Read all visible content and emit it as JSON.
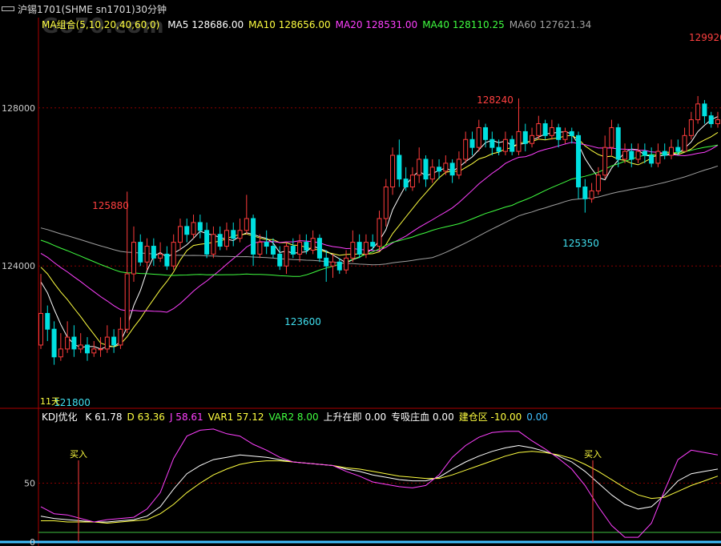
{
  "title": "沪锡1701(SHME sn1701)30分钟",
  "watermark": "Go70.com",
  "ma_legend": {
    "combo": "MA组合(5,10,20,40,60,0)",
    "items": [
      {
        "label": "MA5",
        "value": "128686.00",
        "color": "#ffffff"
      },
      {
        "label": "MA10",
        "value": "128656.00",
        "color": "#ffff40"
      },
      {
        "label": "MA20",
        "value": "128531.00",
        "color": "#ff40ff"
      },
      {
        "label": "MA40",
        "value": "128110.25",
        "color": "#40ff40"
      },
      {
        "label": "MA60",
        "value": "127621.34",
        "color": "#a0a0a0"
      }
    ]
  },
  "kdj_legend": {
    "name": "KDJ优化",
    "items": [
      {
        "label": "K",
        "value": "61.78",
        "color": "#ffffff"
      },
      {
        "label": "D",
        "value": "63.36",
        "color": "#ffff40"
      },
      {
        "label": "J",
        "value": "58.61",
        "color": "#ff40ff"
      },
      {
        "label": "VAR1",
        "value": "57.12",
        "color": "#ffff40"
      },
      {
        "label": "VAR2",
        "value": "8.00",
        "color": "#40ff40"
      },
      {
        "label": "上升在即",
        "value": "0.00",
        "color": "#ffffff"
      },
      {
        "label": "专吸庄血",
        "value": "0.00",
        "color": "#ffffff"
      },
      {
        "label": "建仓区",
        "value": "-10.00",
        "color": "#ffff40"
      },
      {
        "label": "",
        "value": "0.00",
        "color": "#40c0ff"
      }
    ]
  },
  "axis": {
    "price_ticks": [
      "128000",
      "124000"
    ],
    "kdj_ticks": [
      "50",
      "0"
    ],
    "date_label": "11天"
  },
  "annotations": {
    "high_right": "129920",
    "peak_mid": "128240",
    "peak_left": "125880",
    "low_mid": "123600",
    "low_right": "125350",
    "low_left": "121800"
  },
  "buy_signals": [
    "买入",
    "买入"
  ],
  "colors": {
    "up": "#ff3c3c",
    "down": "#00e0e0",
    "grid": "#8b0000",
    "axis": "#aa0000",
    "high_label": "#ff4040",
    "low_label": "#40e0f0"
  },
  "chart_data": {
    "type": "candlestick",
    "price_range": [
      120500,
      129920
    ],
    "kdj_range": [
      0,
      100
    ],
    "candles": [
      [
        122000,
        122800,
        123800,
        121900
      ],
      [
        122800,
        122400,
        123000,
        122100
      ],
      [
        122400,
        121700,
        122600,
        121500
      ],
      [
        121700,
        121900,
        122300,
        121600
      ],
      [
        121900,
        122200,
        122600,
        121800
      ],
      [
        122200,
        121900,
        122500,
        121700
      ],
      [
        121900,
        122000,
        122300,
        121800
      ],
      [
        122000,
        121800,
        122200,
        121600
      ],
      [
        121800,
        121900,
        122100,
        121700
      ],
      [
        121900,
        121900,
        122200,
        121700
      ],
      [
        121900,
        122200,
        122500,
        121800
      ],
      [
        122200,
        122000,
        122400,
        121800
      ],
      [
        122000,
        122400,
        122700,
        121900
      ],
      [
        122400,
        123800,
        125880,
        122300
      ],
      [
        123800,
        124600,
        125000,
        123600
      ],
      [
        124600,
        124100,
        124800,
        124000
      ],
      [
        124100,
        124500,
        124700,
        123900
      ],
      [
        124500,
        124200,
        124700,
        124000
      ],
      [
        124200,
        124300,
        124600,
        124100
      ],
      [
        124300,
        124000,
        124500,
        123900
      ],
      [
        124000,
        124600,
        124800,
        123900
      ],
      [
        124600,
        125000,
        125200,
        124400
      ],
      [
        125000,
        124800,
        125200,
        124600
      ],
      [
        124800,
        125100,
        125300,
        124700
      ],
      [
        125100,
        124900,
        125300,
        124700
      ],
      [
        124900,
        124300,
        125100,
        124200
      ],
      [
        124300,
        124800,
        125000,
        124200
      ],
      [
        124800,
        124500,
        125000,
        124400
      ],
      [
        124500,
        124900,
        125100,
        124400
      ],
      [
        124900,
        124700,
        125100,
        124500
      ],
      [
        124700,
        124900,
        125200,
        124600
      ],
      [
        124900,
        125200,
        125800,
        124800
      ],
      [
        125200,
        124300,
        125300,
        124000
      ],
      [
        124300,
        124600,
        124800,
        124200
      ],
      [
        124600,
        124500,
        124900,
        124300
      ],
      [
        124500,
        124300,
        124700,
        124200
      ],
      [
        124300,
        124000,
        124500,
        123900
      ],
      [
        124000,
        124500,
        124600,
        123800
      ],
      [
        124500,
        124300,
        124700,
        124200
      ],
      [
        124300,
        124600,
        124800,
        124100
      ],
      [
        124600,
        124400,
        124800,
        124300
      ],
      [
        124400,
        124700,
        124900,
        124300
      ],
      [
        124700,
        124200,
        124800,
        124100
      ],
      [
        124200,
        124000,
        124400,
        123600
      ],
      [
        124000,
        124100,
        124300,
        123700
      ],
      [
        124100,
        123900,
        124200,
        123800
      ],
      [
        123900,
        124200,
        124400,
        123800
      ],
      [
        124200,
        124600,
        124900,
        124100
      ],
      [
        124600,
        124300,
        124800,
        124200
      ],
      [
        124300,
        124600,
        124800,
        124200
      ],
      [
        124600,
        124500,
        124800,
        124400
      ],
      [
        124500,
        125200,
        125400,
        124400
      ],
      [
        125200,
        126000,
        126200,
        125000
      ],
      [
        126000,
        126800,
        127000,
        125800
      ],
      [
        126800,
        126200,
        127200,
        126000
      ],
      [
        126200,
        126000,
        126500,
        125900
      ],
      [
        126000,
        126300,
        126500,
        125900
      ],
      [
        126300,
        126700,
        127000,
        126100
      ],
      [
        126700,
        126200,
        126800,
        126000
      ],
      [
        126200,
        126500,
        126700,
        126100
      ],
      [
        126500,
        126400,
        126700,
        126200
      ],
      [
        126400,
        126600,
        126800,
        126300
      ],
      [
        126600,
        126300,
        126700,
        126100
      ],
      [
        126300,
        126700,
        126900,
        126200
      ],
      [
        126700,
        127200,
        127400,
        126600
      ],
      [
        127200,
        127000,
        127400,
        126800
      ],
      [
        127000,
        127500,
        127700,
        126900
      ],
      [
        127500,
        127200,
        127600,
        127000
      ],
      [
        127200,
        127000,
        127400,
        126800
      ],
      [
        127000,
        126900,
        127200,
        126800
      ],
      [
        126900,
        127200,
        127400,
        126800
      ],
      [
        127200,
        126900,
        127300,
        126800
      ],
      [
        126900,
        127400,
        128240,
        126800
      ],
      [
        127400,
        127100,
        127600,
        126900
      ],
      [
        127100,
        127300,
        127500,
        127000
      ],
      [
        127300,
        127600,
        127800,
        127200
      ],
      [
        127600,
        127300,
        127700,
        127200
      ],
      [
        127300,
        127500,
        127700,
        127200
      ],
      [
        127500,
        127200,
        127600,
        127000
      ],
      [
        127200,
        127400,
        127500,
        127100
      ],
      [
        127400,
        127300,
        127500,
        127100
      ],
      [
        127300,
        126000,
        127400,
        125700
      ],
      [
        126000,
        125700,
        126200,
        125350
      ],
      [
        125700,
        125900,
        126100,
        125600
      ],
      [
        125900,
        126300,
        126500,
        125800
      ],
      [
        126300,
        127000,
        127300,
        126200
      ],
      [
        127000,
        127500,
        127700,
        126800
      ],
      [
        127500,
        126700,
        127600,
        126500
      ],
      [
        126700,
        126900,
        127100,
        126600
      ],
      [
        126900,
        126700,
        127100,
        126500
      ],
      [
        126700,
        126900,
        127100,
        126600
      ],
      [
        126900,
        126800,
        127100,
        126600
      ],
      [
        126800,
        126600,
        127000,
        126500
      ],
      [
        126600,
        126900,
        127100,
        126500
      ],
      [
        126900,
        126800,
        127100,
        126700
      ],
      [
        126800,
        127000,
        127200,
        126700
      ],
      [
        127000,
        126900,
        127200,
        126800
      ],
      [
        126900,
        127300,
        127500,
        126900
      ],
      [
        127300,
        127700,
        127900,
        127200
      ],
      [
        127700,
        128100,
        128300,
        127600
      ],
      [
        128100,
        127800,
        128200,
        127600
      ],
      [
        127800,
        127600,
        127900,
        127500
      ],
      [
        127600,
        127700,
        127900,
        127500
      ]
    ],
    "kdj": {
      "K": [
        22,
        20,
        19,
        18,
        17,
        17,
        18,
        19,
        22,
        30,
        45,
        58,
        65,
        70,
        72,
        74,
        73,
        72,
        70,
        68,
        67,
        66,
        65,
        62,
        60,
        57,
        55,
        53,
        52,
        52,
        55,
        62,
        68,
        73,
        77,
        80,
        82,
        80,
        77,
        73,
        68,
        60,
        50,
        40,
        32,
        28,
        30,
        40,
        52,
        58,
        60,
        62
      ],
      "D": [
        18,
        18,
        17,
        17,
        17,
        16,
        17,
        18,
        19,
        24,
        32,
        42,
        50,
        57,
        62,
        66,
        68,
        69,
        69,
        68,
        67,
        66,
        65,
        63,
        62,
        60,
        58,
        56,
        55,
        54,
        54,
        57,
        61,
        65,
        69,
        73,
        76,
        77,
        76,
        74,
        71,
        66,
        60,
        53,
        46,
        40,
        37,
        38,
        43,
        48,
        52,
        56
      ],
      "J": [
        30,
        24,
        23,
        20,
        17,
        19,
        20,
        21,
        28,
        42,
        71,
        90,
        95,
        96,
        92,
        90,
        83,
        78,
        72,
        68,
        67,
        66,
        65,
        60,
        56,
        51,
        49,
        47,
        46,
        48,
        57,
        72,
        82,
        89,
        93,
        94,
        94,
        86,
        79,
        71,
        62,
        48,
        30,
        14,
        4,
        4,
        16,
        44,
        70,
        78,
        76,
        74
      ]
    }
  }
}
